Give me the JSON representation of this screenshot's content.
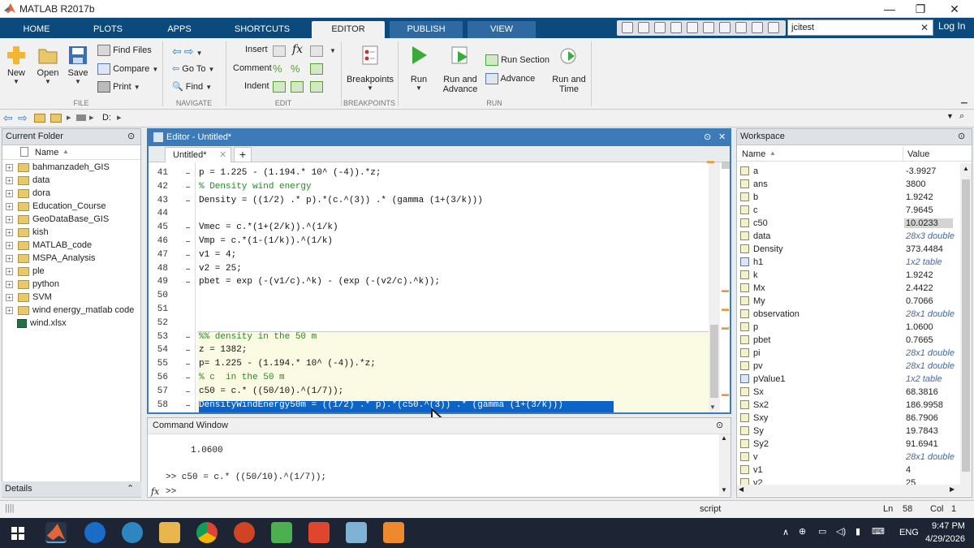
{
  "window": {
    "title": "MATLAB R2017b"
  },
  "tabs": [
    "HOME",
    "PLOTS",
    "APPS",
    "SHORTCUTS",
    "EDITOR",
    "PUBLISH",
    "VIEW"
  ],
  "search": {
    "value": "jcitest"
  },
  "login": "Log In",
  "ribbon": {
    "file": {
      "new": "New",
      "open": "Open",
      "save": "Save",
      "find_files": "Find Files",
      "compare": "Compare",
      "print": "Print",
      "group": "FILE"
    },
    "navigate": {
      "goto": "Go To",
      "find": "Find",
      "group": "NAVIGATE"
    },
    "edit": {
      "insert": "Insert",
      "comment": "Comment",
      "indent": "Indent",
      "group": "EDIT"
    },
    "breakpoints": {
      "label": "Breakpoints",
      "group": "BREAKPOINTS"
    },
    "run": {
      "run": "Run",
      "run_advance_1": "Run and",
      "run_advance_2": "Advance",
      "run_section": "Run Section",
      "advance": "Advance",
      "run_time_1": "Run and",
      "run_time_2": "Time",
      "group": "RUN"
    }
  },
  "address": {
    "path": "D:"
  },
  "folder": {
    "title": "Current Folder",
    "col": "Name",
    "items": [
      "bahmanzadeh_GIS",
      "data",
      "dora",
      "Education_Course",
      "GeoDataBase_GIS",
      "kish",
      "MATLAB_code",
      "MSPA_Analysis",
      "ple",
      "python",
      "SVM",
      "wind energy_matlab code"
    ],
    "file": "wind.xlsx",
    "details": "Details"
  },
  "editor": {
    "title": "Editor - Untitled*",
    "tab": "Untitled*",
    "lines": [
      {
        "n": "41",
        "t": "p = 1.225 - (1.194.* 10^ (-4)).*z;",
        "c": false
      },
      {
        "n": "42",
        "t": "% Density wind energy",
        "c": true
      },
      {
        "n": "43",
        "t": "Density = ((1/2) .* p).*(c.^(3)) .* (gamma (1+(3/k)))",
        "c": false
      },
      {
        "n": "44",
        "t": "",
        "c": false
      },
      {
        "n": "45",
        "t": "Vmec = c.*(1+(2/k)).^(1/k)",
        "c": false
      },
      {
        "n": "46",
        "t": "Vmp = c.*(1-(1/k)).^(1/k)",
        "c": false
      },
      {
        "n": "47",
        "t": "v1 = 4;",
        "c": false
      },
      {
        "n": "48",
        "t": "v2 = 25;",
        "c": false
      },
      {
        "n": "49",
        "t": "pbet = exp (-(v1/c).^k) - (exp (-(v2/c).^k));",
        "c": false
      },
      {
        "n": "50",
        "t": "",
        "c": false
      },
      {
        "n": "51",
        "t": "",
        "c": false
      },
      {
        "n": "52",
        "t": "",
        "c": false
      },
      {
        "n": "53",
        "t": "%% density in the 50 m",
        "c": true
      },
      {
        "n": "54",
        "t": "z = 1382;",
        "c": false
      },
      {
        "n": "55",
        "t": "p= 1.225 - (1.194.* 10^ (-4)).*z;",
        "c": false
      },
      {
        "n": "56",
        "t": "% c  in the 50 m",
        "c": true
      },
      {
        "n": "57",
        "t": "c50 = c.* ((50/10).^(1/7));",
        "c": false
      },
      {
        "n": "58",
        "t": "DensityWindEnergy50m = ((1/2) .* p).*(c50.^(3)) .* (gamma (1+(3/k)))",
        "c": false
      }
    ]
  },
  "command": {
    "title": "Command Window",
    "output": "1.0600",
    "history": ">> c50 = c.* ((50/10).^(1/7));",
    "prompt": ">>",
    "fx": "fx"
  },
  "workspace": {
    "title": "Workspace",
    "col_name": "Name",
    "col_value": "Value",
    "vars": [
      {
        "name": "a",
        "value": "-3.9927",
        "kind": "num"
      },
      {
        "name": "ans",
        "value": "3800",
        "kind": "num"
      },
      {
        "name": "b",
        "value": "1.9242",
        "kind": "num"
      },
      {
        "name": "c",
        "value": "7.9645",
        "kind": "num"
      },
      {
        "name": "c50",
        "value": "10.0233",
        "kind": "num"
      },
      {
        "name": "data",
        "value": "28x3 double",
        "kind": "arr"
      },
      {
        "name": "Density",
        "value": "373.4484",
        "kind": "num"
      },
      {
        "name": "h1",
        "value": "1x2 table",
        "kind": "tbl"
      },
      {
        "name": "k",
        "value": "1.9242",
        "kind": "num"
      },
      {
        "name": "Mx",
        "value": "2.4422",
        "kind": "num"
      },
      {
        "name": "My",
        "value": "0.7066",
        "kind": "num"
      },
      {
        "name": "observation",
        "value": "28x1 double",
        "kind": "arr"
      },
      {
        "name": "p",
        "value": "1.0600",
        "kind": "num"
      },
      {
        "name": "pbet",
        "value": "0.7665",
        "kind": "num"
      },
      {
        "name": "pi",
        "value": "28x1 double",
        "kind": "arr"
      },
      {
        "name": "pv",
        "value": "28x1 double",
        "kind": "arr"
      },
      {
        "name": "pValue1",
        "value": "1x2 table",
        "kind": "tbl"
      },
      {
        "name": "Sx",
        "value": "68.3816",
        "kind": "num"
      },
      {
        "name": "Sx2",
        "value": "186.9958",
        "kind": "num"
      },
      {
        "name": "Sxy",
        "value": "86.7906",
        "kind": "num"
      },
      {
        "name": "Sy",
        "value": "19.7843",
        "kind": "num"
      },
      {
        "name": "Sy2",
        "value": "91.6941",
        "kind": "num"
      },
      {
        "name": "v",
        "value": "28x1 double",
        "kind": "arr"
      },
      {
        "name": "v1",
        "value": "4",
        "kind": "num"
      },
      {
        "name": "v2",
        "value": "25",
        "kind": "num"
      }
    ]
  },
  "status": {
    "mode": "script",
    "ln_label": "Ln",
    "ln": "58",
    "col_label": "Col",
    "col": "1"
  },
  "taskbar": {
    "time": "9:47 PM",
    "date": "4/29/2026",
    "lang": "ENG"
  },
  "colors": {
    "accent": "#0c4a7d",
    "editor_border": "#3c7ab8",
    "selection": "#0c64c9",
    "comment": "#228b22"
  }
}
